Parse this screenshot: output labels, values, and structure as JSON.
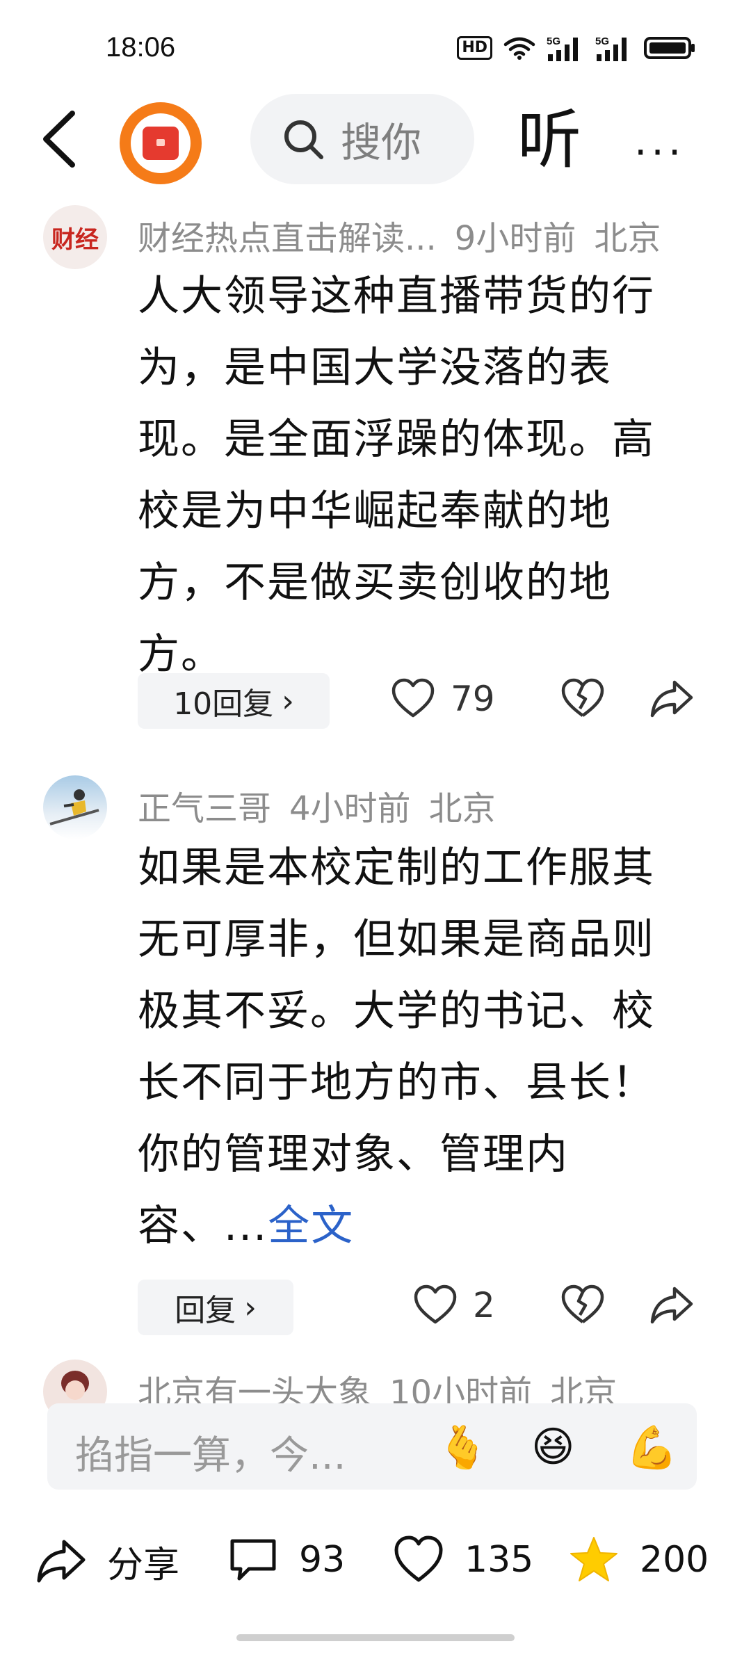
{
  "status_bar": {
    "time": "18:06",
    "hd": "HD",
    "signal1": "5G",
    "signal2": "5G"
  },
  "nav": {
    "search_placeholder": "搜你",
    "listen": "听",
    "more": "···"
  },
  "comments": [
    {
      "author": "财经热点直击解读...",
      "time": "9小时前",
      "location": "北京",
      "text": "人大领导这种直播带货的行为，是中国大学没落的表现。是全面浮躁的体现。高校是为中华崛起奉献的地方，不是做买卖创收的地方。",
      "reply_label": "10回复",
      "likes": "79",
      "avatar_text": "财经"
    },
    {
      "author": "正气三哥",
      "time": "4小时前",
      "location": "北京",
      "text": "如果是本校定制的工作服其无可厚非，但如果是商品则极其不妥。大学的书记、校长不同于地方的市、县长！你的管理对象、管理内容、...",
      "full_text_link": "全文",
      "reply_label": "回复",
      "likes": "2"
    },
    {
      "author": "北京有一头大象",
      "time": "10小时前",
      "location": "北京"
    }
  ],
  "input": {
    "placeholder": "掐指一算，今...",
    "emojis": [
      "🫰",
      "😆",
      "💪"
    ]
  },
  "bottom": {
    "share": "分享",
    "comments": "93",
    "likes": "135",
    "favorites": "200"
  },
  "colors": {
    "accent_orange": "#f57b18",
    "link_blue": "#2b62c9",
    "star_yellow": "#ffcc00"
  }
}
